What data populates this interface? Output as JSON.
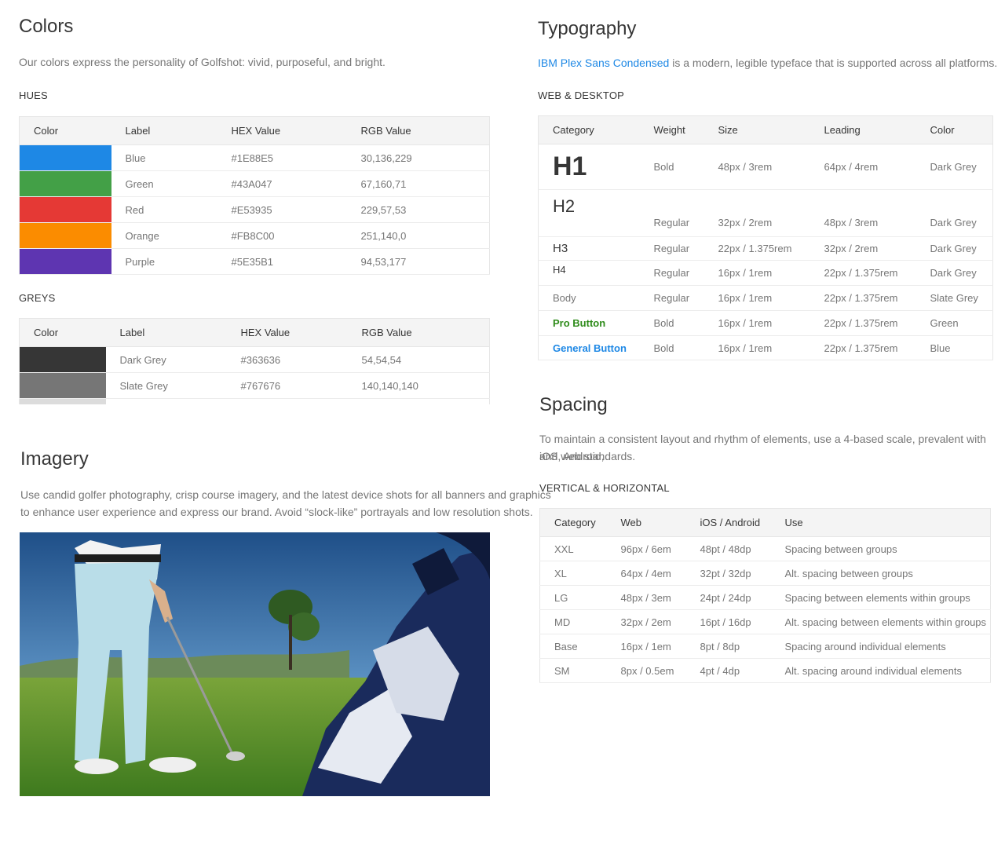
{
  "colors": {
    "title": "Colors",
    "intro": "Our colors express the personality of Golfshot: vivid, purposeful, and bright.",
    "hues_label": "HUES",
    "hues_headers": [
      "Color",
      "Label",
      "HEX Value",
      "RGB Value"
    ],
    "hues": [
      {
        "label": "Blue",
        "hex": "#1E88E5",
        "rgb": "30,136,229",
        "swatch": "#1E88E5"
      },
      {
        "label": "Green",
        "hex": "#43A047",
        "rgb": "67,160,71",
        "swatch": "#43A047"
      },
      {
        "label": "Red",
        "hex": "#E53935",
        "rgb": "229,57,53",
        "swatch": "#E53935"
      },
      {
        "label": "Orange",
        "hex": "#FB8C00",
        "rgb": "251,140,0",
        "swatch": "#FB8C00"
      },
      {
        "label": "Purple",
        "hex": "#5E35B1",
        "rgb": "94,53,177",
        "swatch": "#5E35B1"
      }
    ],
    "greys_label": "GREYS",
    "greys_headers": [
      "Color",
      "Label",
      "HEX Value",
      "RGB Value"
    ],
    "greys": [
      {
        "label": "Dark Grey",
        "hex": "#363636",
        "rgb": "54,54,54",
        "swatch": "#363636"
      },
      {
        "label": "Slate Grey",
        "hex": "#767676",
        "rgb": "140,140,140",
        "swatch": "#767676"
      }
    ]
  },
  "imagery": {
    "title": "Imagery",
    "intro_line1": "Use candid golfer photography, crisp course imagery, and the latest device shots for all banners and graphics",
    "intro_line2": "to enhance user experience and express our brand. Avoid “slock-like” portrayals and low resolution shots."
  },
  "typography": {
    "title": "Typography",
    "font_link": "IBM Plex Sans Condensed",
    "intro_rest": " is a modern, legible typeface that is supported across all platforms.",
    "sub_label": "WEB & DESKTOP",
    "headers": [
      "Category",
      "Weight",
      "Size",
      "Leading",
      "Color"
    ],
    "rows": [
      {
        "category": "H1",
        "weight": "Bold",
        "size": "48px / 3rem",
        "leading": "64px / 4rem",
        "color": "Dark Grey"
      },
      {
        "category": "H2",
        "weight": "Regular",
        "size": "32px / 2rem",
        "leading": "48px / 3rem",
        "color": "Dark Grey"
      },
      {
        "category": "H3",
        "weight": "Regular",
        "size": "22px / 1.375rem",
        "leading": "32px / 2rem",
        "color": "Dark Grey"
      },
      {
        "category": "H4",
        "weight": "Regular",
        "size": "16px / 1rem",
        "leading": "22px / 1.375rem",
        "color": "Dark Grey"
      },
      {
        "category": "Body",
        "weight": "Regular",
        "size": "16px / 1rem",
        "leading": "22px / 1.375rem",
        "color": "Slate Grey"
      },
      {
        "category": "Pro Button",
        "weight": "Bold",
        "size": "16px / 1rem",
        "leading": "22px / 1.375rem",
        "color": "Green"
      },
      {
        "category": "General Button",
        "weight": "Bold",
        "size": "16px / 1rem",
        "leading": "22px / 1.375rem",
        "color": "Blue"
      }
    ]
  },
  "spacing": {
    "title": "Spacing",
    "intro_line1": "To maintain a consistent layout and rhythm of elements, use a 4-based scale, prevalent with iOS, Android,",
    "intro_line2": "and web standards.",
    "sub_label": "VERTICAL & HORIZONTAL",
    "headers": [
      "Category",
      "Web",
      "iOS / Android",
      "Use"
    ],
    "rows": [
      {
        "category": "XXL",
        "web": "96px / 6em",
        "native": "48pt / 48dp",
        "use": "Spacing between groups"
      },
      {
        "category": "XL",
        "web": "64px / 4em",
        "native": "32pt / 32dp",
        "use": "Alt. spacing between groups"
      },
      {
        "category": "LG",
        "web": "48px / 3em",
        "native": "24pt / 24dp",
        "use": "Spacing between elements within groups"
      },
      {
        "category": "MD",
        "web": "32px / 2em",
        "native": "16pt / 16dp",
        "use": "Alt. spacing between elements within groups"
      },
      {
        "category": "Base",
        "web": "16px / 1em",
        "native": "8pt / 8dp",
        "use": "Spacing around individual elements"
      },
      {
        "category": "SM",
        "web": "8px / 0.5em",
        "native": "4pt / 4dp",
        "use": "Alt. spacing around individual elements"
      }
    ]
  }
}
